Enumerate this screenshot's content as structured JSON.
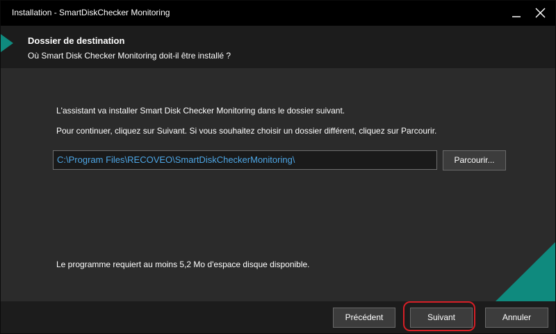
{
  "window": {
    "title": "Installation - SmartDiskChecker Monitoring",
    "minimize_icon": "minimize-icon",
    "close_icon": "close-icon"
  },
  "header": {
    "title": "Dossier de destination",
    "subtitle": "Où Smart Disk Checker Monitoring doit-il être installé ?"
  },
  "content": {
    "intro": "L'assistant va installer Smart Disk Checker Monitoring dans le dossier suivant.",
    "instruction": "Pour continuer, cliquez sur Suivant. Si vous souhaitez choisir un dossier différent, cliquez sur Parcourir.",
    "path_value": "C:\\Program Files\\RECOVEO\\SmartDiskCheckerMonitoring\\",
    "browse_label": "Parcourir...",
    "space_requirement": "Le programme requiert au moins 5,2 Mo d'espace disque disponible."
  },
  "footer": {
    "back_label": "Précédent",
    "next_label": "Suivant",
    "cancel_label": "Annuler"
  },
  "colors": {
    "accent": "#0f8a7e",
    "path_text": "#4ea7e6",
    "highlight": "#d61f26"
  }
}
